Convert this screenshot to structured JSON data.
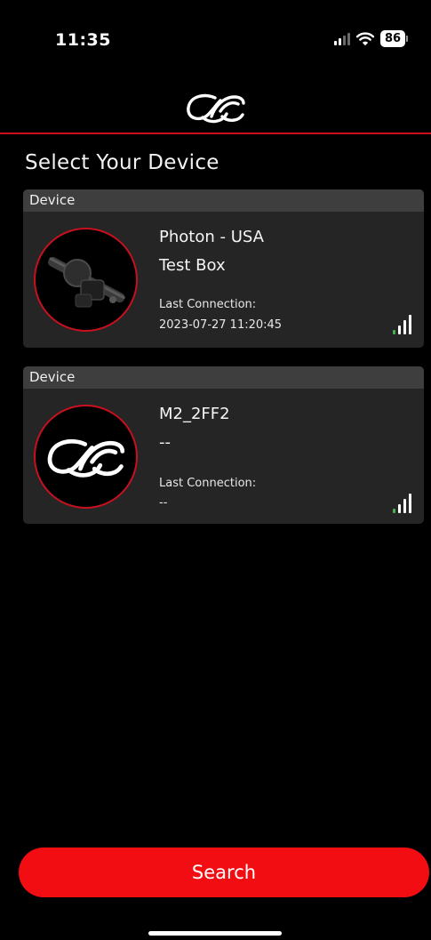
{
  "status_bar": {
    "time": "11:35",
    "battery": "86"
  },
  "header": {
    "logo_icon": "cycling-brand-logo-icon"
  },
  "page_title": "Select Your Device",
  "devices": [
    {
      "section_label": "Device",
      "name": "Photon - USA",
      "subtitle": "Test Box",
      "last_connection_label": "Last Connection:",
      "last_connection_value": "2023-07-27 11:20:45",
      "image": "bike-crank-motor-image",
      "signal_icon": "signal-strength-icon"
    },
    {
      "section_label": "Device",
      "name": "M2_2FF2",
      "subtitle": "--",
      "last_connection_label": "Last Connection:",
      "last_connection_value": "--",
      "image": "brand-logo-image",
      "signal_icon": "signal-strength-icon"
    }
  ],
  "search_button": {
    "label": "Search"
  },
  "colors": {
    "accent": "#c8101e",
    "button": "#f10d12",
    "signal_green": "#4caf50",
    "card_bg": "#252525",
    "card_header_bg": "#3e3e3e"
  }
}
